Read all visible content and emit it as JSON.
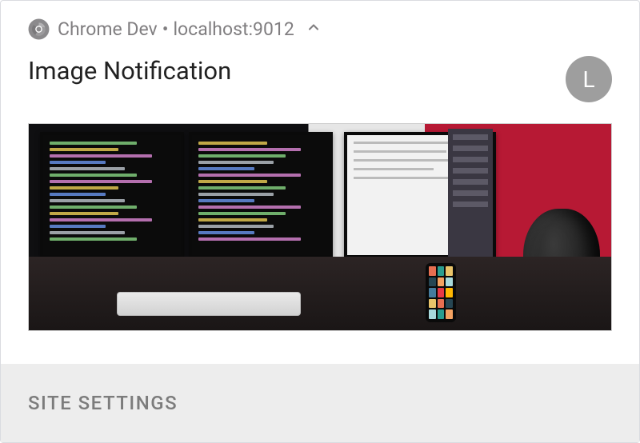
{
  "header": {
    "app_name": "Chrome Dev",
    "separator": " • ",
    "origin": "localhost:9012"
  },
  "notification": {
    "title": "Image Notification",
    "avatar_letter": "L"
  },
  "footer": {
    "button_label": "SITE SETTINGS"
  }
}
